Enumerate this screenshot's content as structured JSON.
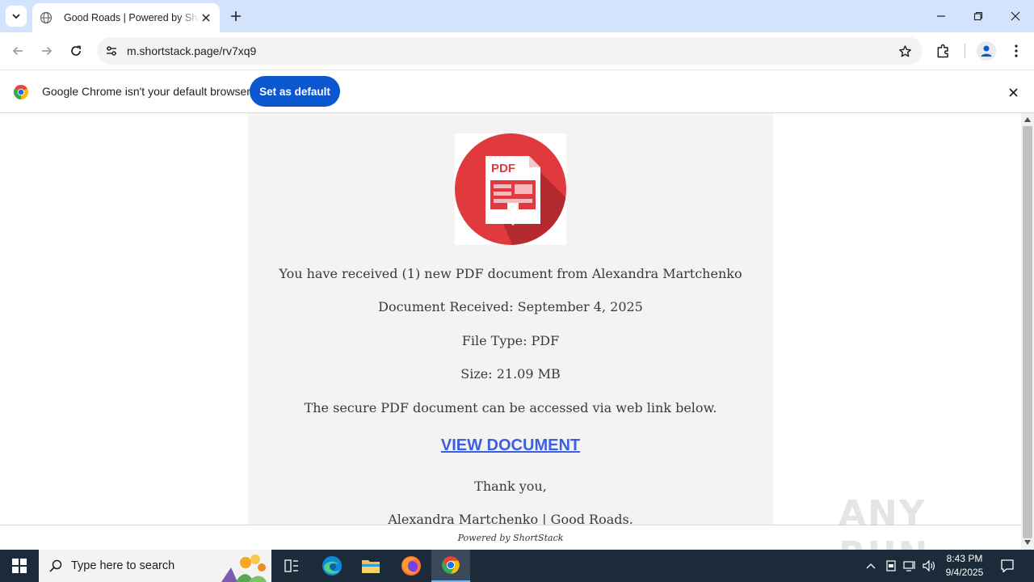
{
  "browser": {
    "tab": {
      "title": "Good Roads | Powered by ShortStack",
      "favicon": "globe-icon"
    },
    "url": "m.shortstack.page/rv7xq9",
    "icons": {
      "tab_search": "chevron-down-icon",
      "new_tab": "plus-icon",
      "back": "arrow-left-icon",
      "forward": "arrow-right-icon",
      "reload": "reload-icon",
      "site_info": "tune-icon",
      "bookmark": "star-icon",
      "extensions": "puzzle-icon",
      "profile": "person-icon",
      "menu": "kebab-icon"
    }
  },
  "infobar": {
    "message": "Google Chrome isn't your default browser",
    "button": "Set as default"
  },
  "page": {
    "icon": "pdf-download-icon",
    "lines": [
      "You have received (1) new PDF document from Alexandra Martchenko",
      "Document Received: September 4, 2025",
      "File Type: PDF",
      "Size: 21.09 MB",
      "The secure PDF document can be accessed via web link below."
    ],
    "link": "VIEW DOCUMENT",
    "closing": "Thank you,",
    "signature": "Alexandra Martchenko | Good Roads.",
    "powered_by": "Powered by ShortStack",
    "pdf_label": "PDF"
  },
  "watermark": "ANY RUN",
  "taskbar": {
    "search_placeholder": "Type here to search",
    "time": "8:43 PM",
    "date": "9/4/2025",
    "apps": [
      "task-view-icon",
      "edge-icon",
      "file-explorer-icon",
      "firefox-icon",
      "chrome-icon"
    ]
  },
  "colors": {
    "tabstrip": "#d3e3fd",
    "accent_button": "#0b57d0",
    "link": "#3b5fe0",
    "card_bg": "#f4f3f2",
    "pdf_red": "#e03a3e",
    "taskbar": "#1c2b3a"
  }
}
